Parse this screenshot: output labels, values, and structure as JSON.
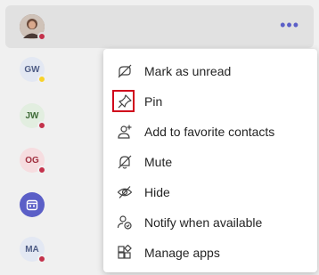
{
  "top_row": {
    "more_label": "•••"
  },
  "contacts": [
    {
      "initials": "GW",
      "bg": "#e3e8f3",
      "fg": "#4f5d86",
      "status": "away"
    },
    {
      "initials": "JW",
      "bg": "#e2eee0",
      "fg": "#3e6b37",
      "status": "busy"
    },
    {
      "initials": "OG",
      "bg": "#f6dde0",
      "fg": "#a03040",
      "status": "busy"
    },
    {
      "initials": "",
      "bg": "#5b5fc7",
      "fg": "#ffffff",
      "status": "none",
      "icon": "calendar-icon"
    },
    {
      "initials": "MA",
      "bg": "#e3e8f3",
      "fg": "#4f5d86",
      "status": "busy"
    }
  ],
  "menu": {
    "items": [
      {
        "label": "Mark as unread",
        "icon": "mark-unread-icon"
      },
      {
        "label": "Pin",
        "icon": "pin-icon"
      },
      {
        "label": "Add to favorite contacts",
        "icon": "add-contact-icon"
      },
      {
        "label": "Mute",
        "icon": "mute-icon"
      },
      {
        "label": "Hide",
        "icon": "hide-icon"
      },
      {
        "label": "Notify when available",
        "icon": "notify-icon"
      },
      {
        "label": "Manage apps",
        "icon": "manage-apps-icon"
      }
    ]
  },
  "colors": {
    "accent": "#5b5fc7",
    "busy": "#c4314b",
    "away": "#f8d22a",
    "highlight": "#d0021b"
  }
}
